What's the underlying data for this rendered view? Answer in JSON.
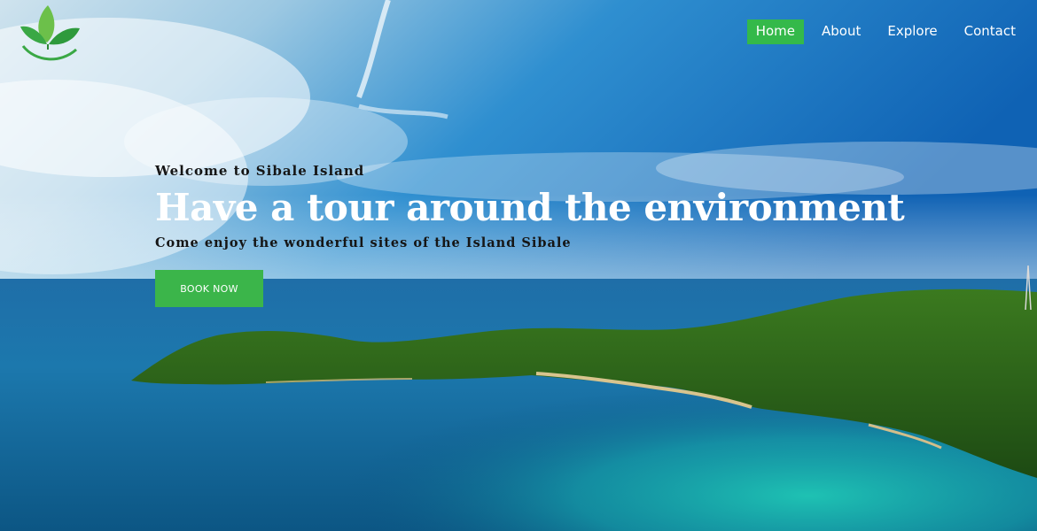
{
  "logo": {
    "icon": "leaf-logo-icon",
    "color": "#3aa845"
  },
  "nav": {
    "items": [
      {
        "label": "Home",
        "active": true
      },
      {
        "label": "About",
        "active": false
      },
      {
        "label": "Explore",
        "active": false
      },
      {
        "label": "Contact",
        "active": false
      }
    ],
    "active_color": "#34b94a"
  },
  "hero": {
    "welcome": "Welcome to Sibale Island",
    "headline": "Have a tour around the environment",
    "subline": "Come enjoy the wonderful sites of the Island Sibale",
    "cta_label": "BOOK NOW",
    "cta_color": "#3bb54a"
  }
}
